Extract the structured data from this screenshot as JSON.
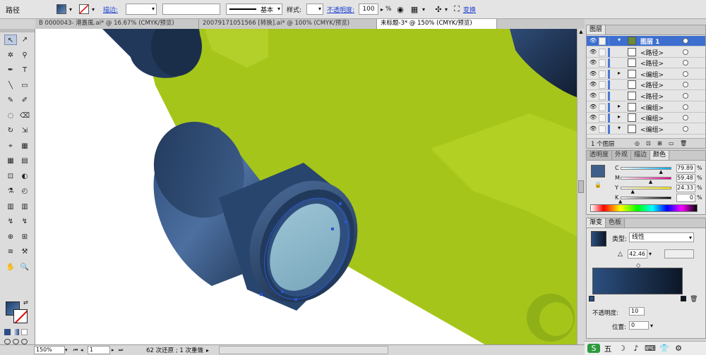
{
  "control_bar": {
    "selection_type": "路径",
    "stroke_label": "描边:",
    "stroke_weight": "",
    "stroke_profile": "基本",
    "style_label": "样式:",
    "opacity_label": "不透明度:",
    "opacity_value": "100",
    "opacity_unit": "%",
    "transform_label": "变换"
  },
  "tabs": [
    {
      "label": "B 0000043- 港嘉風.ai* @ 16.67% (CMYK/预览)"
    },
    {
      "label": "20079171051566 [转换].ai* @ 100% (CMYK/预览)"
    },
    {
      "label": "未标题-3* @ 150% (CMYK/预览)"
    }
  ],
  "tools": [
    "↖",
    "↗",
    "✲",
    "⚲",
    "✒",
    "T",
    "╲",
    "▭",
    "✎",
    "✐",
    "◌",
    "⌫",
    "↻",
    "⇲",
    "⌖",
    "▦",
    "▦",
    "▤",
    "⊡",
    "◐",
    "⚗",
    "◴",
    "▥",
    "▥",
    "↯",
    "↯",
    "⊕",
    "⊞",
    "≋",
    "⚒",
    "✋",
    "🔍"
  ],
  "status_bar": {
    "zoom": "150%",
    "page": "1",
    "info": "62 次还原 ; 1 次重做"
  },
  "layers_panel": {
    "tab": "图层",
    "rows": [
      {
        "name": "图层 1",
        "selected": true,
        "expander": "▾"
      },
      {
        "name": "<路径>",
        "selected": false,
        "expander": ""
      },
      {
        "name": "<路径>",
        "selected": false,
        "expander": ""
      },
      {
        "name": "<编组>",
        "selected": false,
        "expander": "▸"
      },
      {
        "name": "<路径>",
        "selected": false,
        "expander": ""
      },
      {
        "name": "<路径>",
        "selected": false,
        "expander": ""
      },
      {
        "name": "<编组>",
        "selected": false,
        "expander": "▸"
      },
      {
        "name": "<编组>",
        "selected": false,
        "expander": "▸"
      },
      {
        "name": "<编组>",
        "selected": false,
        "expander": "▾"
      }
    ],
    "footer_count": "1 个图层"
  },
  "color_panel": {
    "tabs": [
      "透明度",
      "外观",
      "描边",
      "颜色"
    ],
    "channels": [
      {
        "label": "C",
        "value": "79.89",
        "fill": 0.7989
      },
      {
        "label": "M",
        "value": "59.48",
        "fill": 0.5948
      },
      {
        "label": "Y",
        "value": "24.33",
        "fill": 0.2433
      },
      {
        "label": "K",
        "value": "0",
        "fill": 0
      }
    ],
    "unit": "%",
    "swatch_color": "#3f5f8a"
  },
  "gradient_panel": {
    "tabs": [
      "渐变",
      "色板"
    ],
    "type_label": "类型:",
    "type_value": "线性",
    "angle_value": "42.46",
    "location_label": "位置:",
    "location_value": "0",
    "opacity_label": "不透明度:",
    "opacity_value": "10"
  },
  "taskbar": {
    "items": [
      "S",
      "五",
      "☽",
      "♪",
      "⌨",
      "👕",
      "⚙"
    ]
  },
  "colors": {
    "lime": "#a6c51a",
    "navy": "#1f3351",
    "lens": "#8ab5c8",
    "selection": "#2c55d0"
  }
}
